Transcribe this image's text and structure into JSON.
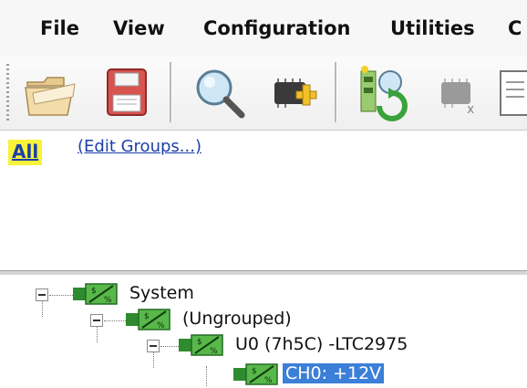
{
  "menu": {
    "items": [
      "File",
      "View",
      "Configuration",
      "Utilities",
      "C"
    ]
  },
  "toolbar": {
    "buttons": [
      "open-folder-icon",
      "save-floppy-icon",
      "search-magnifier-icon",
      "add-device-icon",
      "refresh-scan-icon",
      "remove-device-icon",
      "document-icon"
    ]
  },
  "groups": {
    "all_label": "All",
    "edit_link": "(Edit Groups...)"
  },
  "tree": {
    "nodes": [
      {
        "label": "System",
        "level": 0
      },
      {
        "label": "(Ungrouped)",
        "level": 1
      },
      {
        "label": "U0 (7h5C) -LTC2975",
        "level": 2
      },
      {
        "label": "CH0: +12V",
        "level": 3,
        "selected": true
      }
    ]
  },
  "colors": {
    "highlight": "#f7f33a",
    "link": "#1b3fa8",
    "selection": "#3b7fd9",
    "device_green": "#3aa23a"
  }
}
